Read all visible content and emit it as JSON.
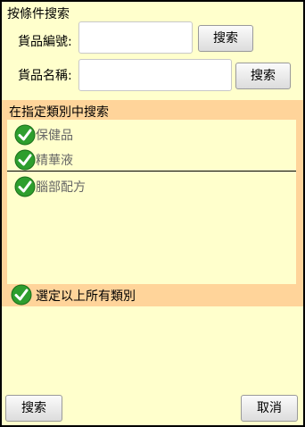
{
  "search": {
    "title": "按條件搜索",
    "code_label": "貨品編號:",
    "code_value": "",
    "code_button": "搜索",
    "name_label": "貨品名稱:",
    "name_value": "",
    "name_button": "搜索"
  },
  "category": {
    "title": "在指定類別中搜索",
    "items": [
      {
        "label": "保健品",
        "checked": true
      },
      {
        "label": "精華液",
        "checked": true
      },
      {
        "label": "腦部配方",
        "checked": true
      }
    ],
    "select_all_label": "選定以上所有類別",
    "select_all_checked": true
  },
  "footer": {
    "search_button": "搜索",
    "cancel_button": "取消"
  },
  "colors": {
    "background": "#FFFFCC",
    "panel": "#FFD49A",
    "check": "#2e9e2e"
  }
}
